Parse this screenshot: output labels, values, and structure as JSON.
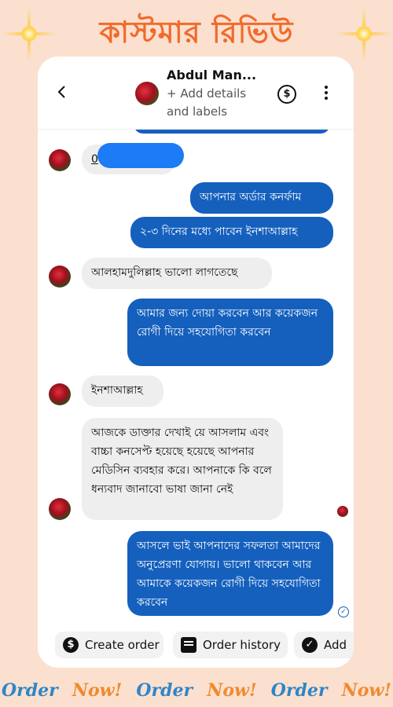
{
  "banner": {
    "title": "কাস্টমার রিভিউ"
  },
  "header": {
    "contact_name": "Abdul Man...",
    "subtitle": "+ Add details and labels"
  },
  "messages": [
    {
      "side": "in",
      "text": "0"
    },
    {
      "side": "out",
      "text": "আপনার অর্ডার কনর্ফাম"
    },
    {
      "side": "out",
      "text": "২-৩ দিনের মধ্যে পাবেন ইনশাআল্লাহ"
    },
    {
      "side": "in",
      "text": "আলহামদুলিল্লাহ ভালো লাগতেছে"
    },
    {
      "side": "out",
      "text": "আমার জন্য দোয়া করবেন আর কয়েকজন রোগী দিয়ে সহযোগিতা করবেন"
    },
    {
      "side": "in",
      "text": "ইনশাআল্লাহ"
    },
    {
      "side": "in",
      "text": "আজকে ডাক্তার দেখাই য়ে আসলাম এবং বাচ্চা কনসেপ্ট হয়েছে হয়েছে আপনার মেডিসিন ব্যবহার করে। আপনাকে কি বলে ধন্যবাদ জানাবো ভাষা জানা নেই"
    },
    {
      "side": "out",
      "text": "আসলে ভাই আপনাদের সফলতা আমাদের অনুপ্রেরণা যোগায়। ভালো থাকবেন আর আমাকে কয়েকজন রোগী দিয়ে সহযোগিতা করবেন"
    }
  ],
  "actions": {
    "create_order": "Create order",
    "order_history": "Order history",
    "add": "Add"
  },
  "footer": [
    "Order",
    "Now!",
    "Order",
    "Now!",
    "Order",
    "Now!"
  ],
  "colors": {
    "bubble_out": "#1560bd",
    "title": "#f26a2b",
    "background": "#fbe0cf"
  }
}
